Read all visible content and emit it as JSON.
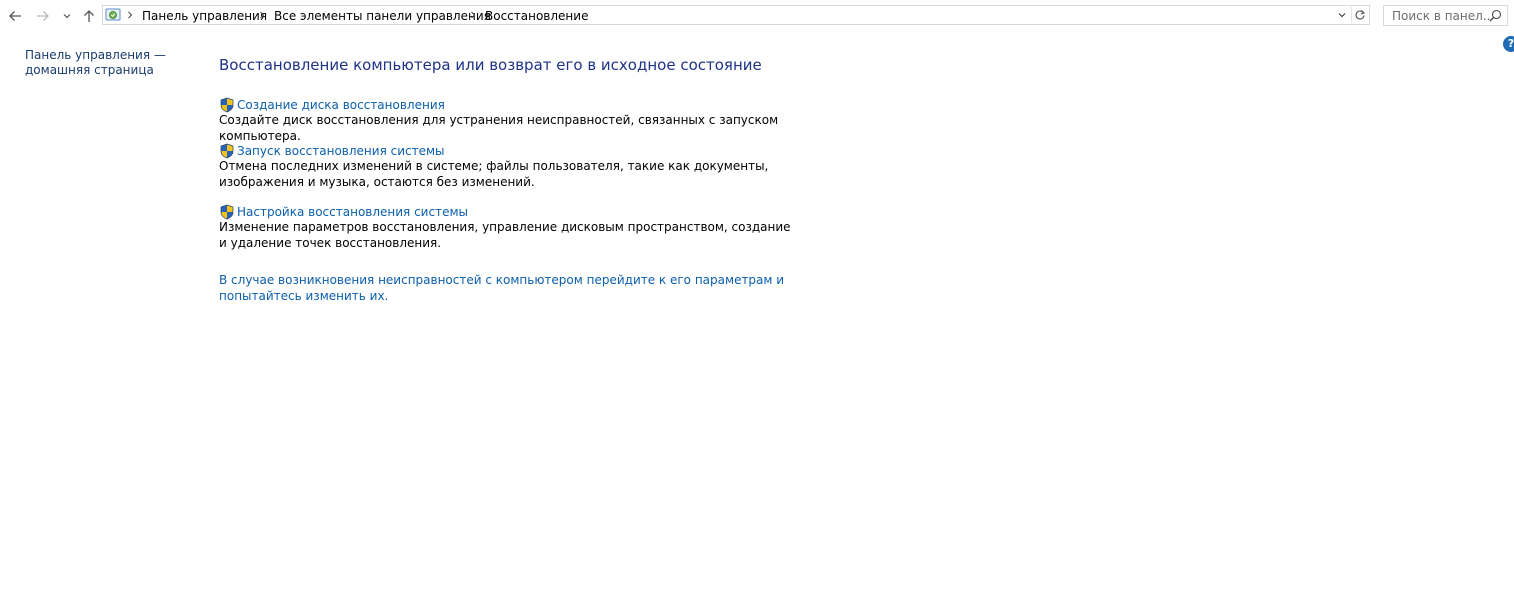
{
  "nav": {
    "back_icon": "arrow-left-icon",
    "forward_icon": "arrow-right-icon",
    "recent_icon": "chevron-down-icon",
    "up_icon": "arrow-up-icon"
  },
  "address": {
    "icon": "control-panel-icon",
    "crumbs": [
      "Панель управления",
      "Все элементы панели управления",
      "Восстановление"
    ]
  },
  "search": {
    "placeholder": "Поиск в панел..."
  },
  "help": {
    "label": "?"
  },
  "sidebar": {
    "home_link": "Панель управления — домашняя страница"
  },
  "main": {
    "title": "Восстановление компьютера или возврат его в исходное состояние",
    "tasks": [
      {
        "link": "Создание диска восстановления",
        "description": "Создайте диск восстановления для устранения неисправностей, связанных с запуском компьютера."
      },
      {
        "link": "Запуск восстановления системы",
        "description": "Отмена последних изменений в системе; файлы пользователя, такие как документы, изображения и музыка, остаются без изменений."
      },
      {
        "link": "Настройка восстановления системы",
        "description": "Изменение параметров восстановления, управление дисковым пространством, создание и удаление точек восстановления."
      }
    ],
    "footer_link": "В случае возникновения неисправностей с компьютером перейдите к его параметрам и попытайтесь изменить их."
  },
  "colors": {
    "link": "#0b5fad",
    "title": "#1e3287",
    "shield_blue": "#2a62b8",
    "shield_yellow": "#f2c417"
  }
}
